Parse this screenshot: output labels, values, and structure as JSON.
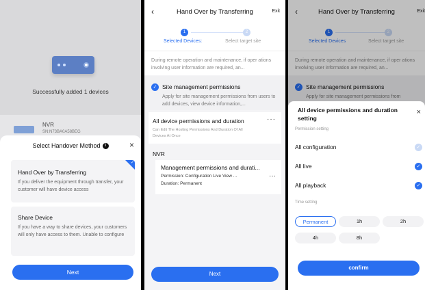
{
  "panel1": {
    "success_text": "Successfully added 1 devices",
    "device": {
      "name": "NVR",
      "sn": "SN:N73BA0A58BEG"
    },
    "sheet_title": "Select Handover Method",
    "info_icon": "i",
    "close_icon": "×",
    "options": [
      {
        "title": "Hand Over by Transferring",
        "desc": "If you deliver the equipment through transfer, your customer will have device access"
      },
      {
        "title": "Share Device",
        "desc": "If you have a way to share devices, your customers will only have access to them. Unable to configure"
      }
    ],
    "next_label": "Next"
  },
  "header": {
    "back": "‹",
    "title": "Hand Over by Transferring",
    "exit": "Exit"
  },
  "steps": {
    "step1_num": "1",
    "step2_num": "2",
    "step1_label": "Selected Devices:",
    "step2_label": "Select target site",
    "step1_label_p3": "Selected Devices"
  },
  "notice": "During remote operation and maintenance, if oper ations involving user information are required, an...",
  "site_perm": {
    "title": "Site management permissions",
    "desc": "Apply for site management permissions from users to add devices, view device information,...",
    "desc_p3": "Apply for site management permissions from"
  },
  "all_device": {
    "title": "All device permissions and duration",
    "desc": "Can Edit The Hosting Permissions And Duration Of All Devices At Once",
    "more": "···"
  },
  "nvr_section": "NVR",
  "nvr_card": {
    "title": "Management permissions and durati...",
    "perm_line": "Permission: Configuration  Live View  ...",
    "duration_line": "Duration: Permanent",
    "more": "···"
  },
  "panel2_next": "Next",
  "panel3": {
    "sheet_title": "All device permissions and duration setting",
    "close_icon": "×",
    "perm_section": "Permission setting",
    "perms": [
      {
        "label": "All configuration",
        "checked": false
      },
      {
        "label": "All live",
        "checked": true
      },
      {
        "label": "All playback",
        "checked": true
      }
    ],
    "time_section": "Time setting",
    "times": [
      "Permanent",
      "1h",
      "2h",
      "4h",
      "8h"
    ],
    "selected_time": "Permanent",
    "confirm_label": "confirm"
  },
  "colors": {
    "accent": "#2a6ff0",
    "disabled": "#c9d9f5"
  }
}
